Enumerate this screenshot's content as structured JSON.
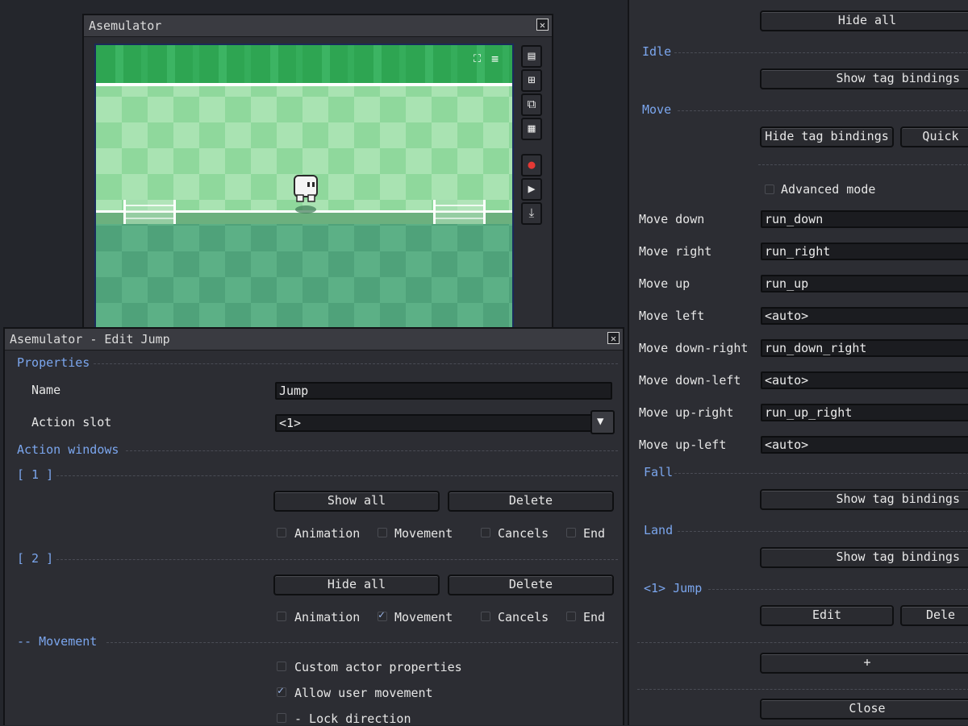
{
  "emu_window": {
    "title": "Asemulator",
    "close": "✕"
  },
  "viewport": {
    "overlay_icons": [
      "⛶",
      "≡"
    ]
  },
  "toolbar": {
    "notes_icon": "▤",
    "add_frame_icon": "⊞",
    "actor_icon": "⧉",
    "film_icon": "▦",
    "record_icon": "●",
    "play_icon": "▶",
    "download_icon": "⤓"
  },
  "right_panel": {
    "hide_all": "Hide all",
    "idle": "Idle",
    "show_tag_bindings": "Show tag bindings",
    "move": "Move",
    "hide_tag_bindings": "Hide tag bindings",
    "quick": "Quick",
    "advanced_mode": "Advanced mode",
    "bindings": [
      {
        "label": "Move down",
        "value": "run_down"
      },
      {
        "label": "Move right",
        "value": "run_right"
      },
      {
        "label": "Move up",
        "value": "run_up"
      },
      {
        "label": "Move left",
        "value": "<auto>"
      },
      {
        "label": "Move down-right",
        "value": "run_down_right"
      },
      {
        "label": "Move down-left",
        "value": "<auto>"
      },
      {
        "label": "Move up-right",
        "value": "run_up_right"
      },
      {
        "label": "Move up-left",
        "value": "<auto>"
      }
    ],
    "fall": "Fall",
    "land": "Land",
    "jump_section": "<1> Jump",
    "edit": "Edit",
    "delete_partial": "Dele",
    "add": "+",
    "close": "Close"
  },
  "edit_window": {
    "title": "Asemulator - Edit Jump",
    "close": "✕",
    "properties": "Properties",
    "name_label": "Name",
    "name_value": "Jump",
    "slot_label": "Action slot",
    "slot_value": "<1>",
    "action_windows": "Action windows",
    "win1": "[ 1 ]",
    "win2": "[ 2 ]",
    "show_all": "Show all",
    "hide_all": "Hide all",
    "delete": "Delete",
    "animation": "Animation",
    "movement": "Movement",
    "cancels": "Cancels",
    "end": "End",
    "movement_section": "-- Movement",
    "custom_actor": "Custom actor properties",
    "allow_user": "Allow user movement",
    "lock_dir": "- Lock direction",
    "dropdown_icon": "▼",
    "check_glyph": "✓"
  },
  "colors": {
    "accent": "#7ba6ee",
    "record": "#e53935",
    "sky_dark": "#2ea552",
    "grass": "#8fd89c"
  }
}
